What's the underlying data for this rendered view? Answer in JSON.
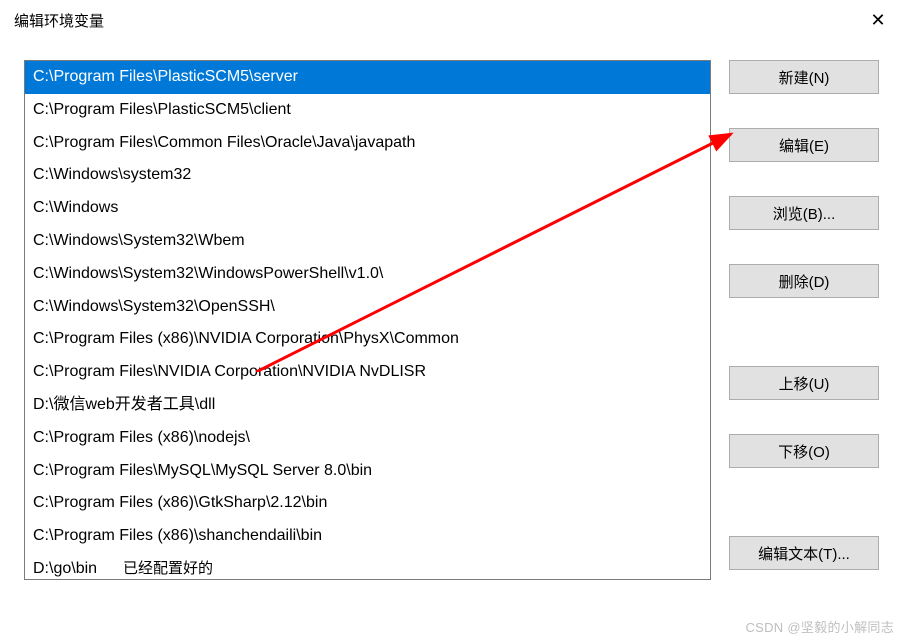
{
  "window": {
    "title": "编辑环境变量",
    "close_icon": "✕"
  },
  "list": {
    "items": [
      "C:\\Program Files\\PlasticSCM5\\server",
      "C:\\Program Files\\PlasticSCM5\\client",
      "C:\\Program Files\\Common Files\\Oracle\\Java\\javapath",
      "C:\\Windows\\system32",
      "C:\\Windows",
      "C:\\Windows\\System32\\Wbem",
      "C:\\Windows\\System32\\WindowsPowerShell\\v1.0\\",
      "C:\\Windows\\System32\\OpenSSH\\",
      "C:\\Program Files (x86)\\NVIDIA Corporation\\PhysX\\Common",
      "C:\\Program Files\\NVIDIA Corporation\\NVIDIA NvDLISR",
      "D:\\微信web开发者工具\\dll",
      "C:\\Program Files (x86)\\nodejs\\",
      "C:\\Program Files\\MySQL\\MySQL Server 8.0\\bin",
      "C:\\Program Files (x86)\\GtkSharp\\2.12\\bin",
      "C:\\Program Files (x86)\\shanchendaili\\bin",
      "D:\\go\\bin"
    ],
    "annotation": "已经配置好的",
    "selected_index": 0
  },
  "buttons": {
    "new": "新建(N)",
    "edit": "编辑(E)",
    "browse": "浏览(B)...",
    "delete": "删除(D)",
    "moveup": "上移(U)",
    "movedown": "下移(O)",
    "edittext": "编辑文本(T)..."
  },
  "watermark": "CSDN @坚毅的小解同志",
  "arrow_color": "#ff0000"
}
